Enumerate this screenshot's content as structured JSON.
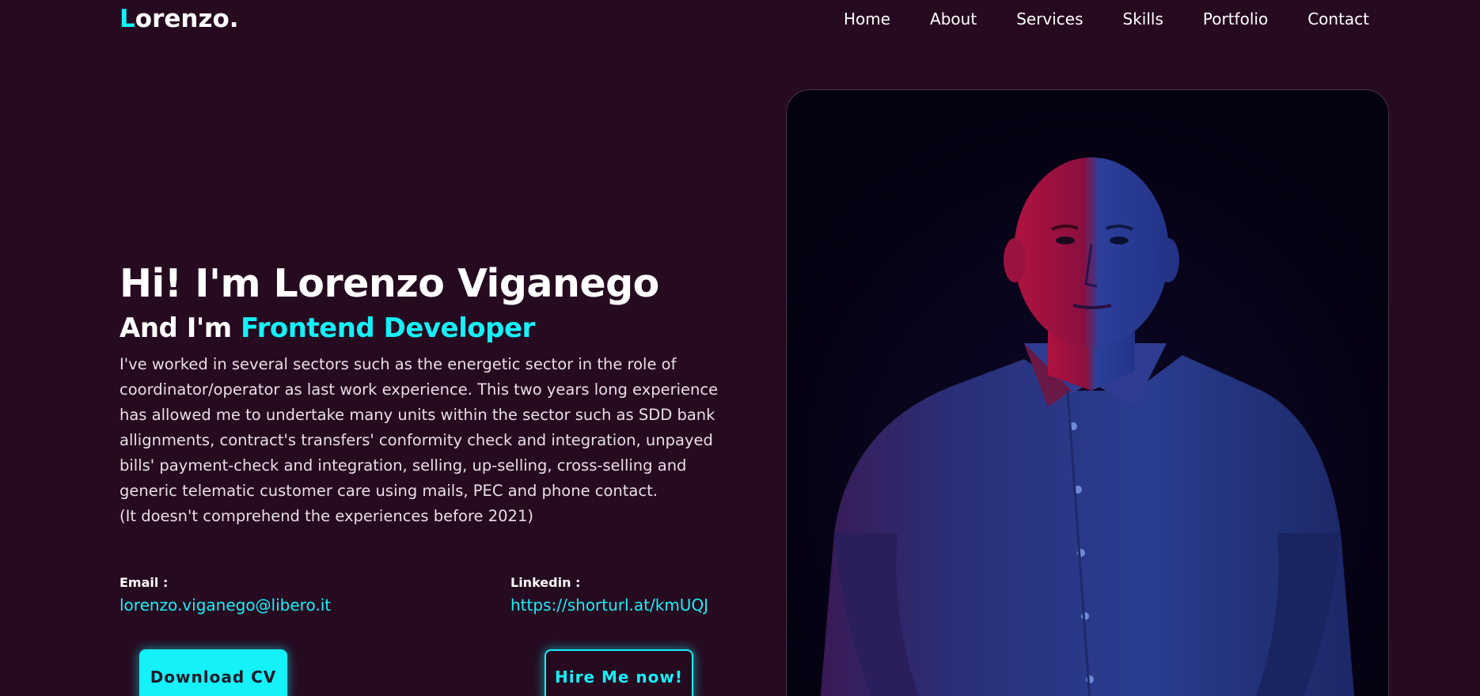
{
  "header": {
    "logo_first_letter": "L",
    "logo_rest": "orenzo.",
    "nav": [
      "Home",
      "About",
      "Services",
      "Skills",
      "Portfolio",
      "Contact"
    ]
  },
  "hero": {
    "title": "Hi! I'm Lorenzo Viganego",
    "subtitle_prefix": "And I'm ",
    "subtitle_role": "Frontend Developer",
    "description": "I've worked in several sectors such as the energetic sector in the role of coordinator/operator as last work experience. This two years long experience has allowed me to undertake many units within the sector such as SDD bank allignments, contract's transfers' conformity check and integration, unpayed bills' payment-check and integration, selling, up-selling, cross-selling and generic telematic customer care using mails, PEC and phone contact.",
    "note": "(It doesn't comprehend the experiences before 2021)"
  },
  "contacts": {
    "email_label": "Email :",
    "email_value": "lorenzo.viganego@libero.it",
    "linkedin_label": "Linkedin :",
    "linkedin_value": "https://shorturl.at/kmUQJ"
  },
  "buttons": {
    "download_cv": "Download CV",
    "hire_me": "Hire Me now!"
  },
  "colors": {
    "background": "#260a20",
    "accent": "#14f1f9",
    "text": "#ffffff"
  }
}
